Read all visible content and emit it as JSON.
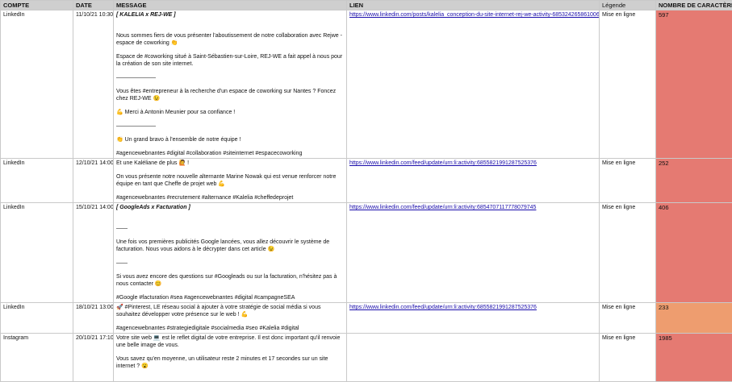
{
  "columns": {
    "compte": "COMPTE",
    "date": "DATE",
    "message": "MESSAGE",
    "lien": "LIEN",
    "legende": "Légende",
    "nombre": "NOMBRE DE CARACTÈRES"
  },
  "colors": {
    "red": "#e57a72",
    "orange": "#ee9d6f",
    "header": "#cfcfcf"
  },
  "rows": [
    {
      "compte": "LinkedIn",
      "date": "11/10/21 10:30",
      "lines": [
        "[ KALELIA x REJ-WE ]",
        "",
        "Nous sommes fiers de vous présenter l'aboutissement de notre collaboration avec Rejwe - espace de coworking 👏",
        "Espace de #coworking situé à Saint-Sébastien-sur-Loire, REJ-WE a fait appel à nous pour la création de son site internet.",
        "———————",
        "Vous êtes #entrepreneur à la recherche d'un espace de coworking sur Nantes ? Foncez chez REJ-WE 😉",
        "💪 Merci à Antonin Meunier pour sa confiance !",
        "———————",
        "👏 Un grand bravo à l'ensemble de notre équipe !",
        "#agencewebnantes #digital #collaboration #siteinternet #espacecoworking"
      ],
      "lien": "https://www.linkedin.com/posts/kalelia_conception-du-site-internet-rej-we-activity-6853242658610061313",
      "legende": "Mise en ligne",
      "nombre": "597",
      "level": "red"
    },
    {
      "compte": "LinkedIn",
      "date": "12/10/21 14:00",
      "lines": [
        "Et une Kaléliane de plus 🙋 !",
        "On vous présente notre nouvelle alternante Marine Nowak qui est venue renforcer notre équipe en tant que Cheffe de projet web 💪",
        "#agencewebnantes #recrutement #alternance #Kalelia #cheffedeprojet"
      ],
      "lien": "https://www.linkedin.com/feed/update/urn:li:activity:6855821991287525376",
      "legende": "Mise en ligne",
      "nombre": "252",
      "level": "red"
    },
    {
      "compte": "LinkedIn",
      "date": "15/10/21 14:00",
      "lines": [
        "[ GoogleAds x Facturation ]",
        "",
        "——",
        "Une fois vos premières publicités Google lancées, vous allez découvrir le système de facturation. Nous vous aidons à le décrypter dans cet article 😉",
        "——",
        "Si vous avez encore des questions sur #Googleads ou sur la facturation, n'hésitez pas à nous contacter 😊",
        "#Google #facturation #sea #agencewebnantes #digital #campagneSEA"
      ],
      "lien": "https://www.linkedin.com/feed/update/urn:li:activity:6854707117778079745",
      "legende": "Mise en ligne",
      "nombre": "406",
      "level": "red"
    },
    {
      "compte": "LinkedIn",
      "date": "18/10/21 13:00",
      "lines": [
        "🚀 #Pinterest, LE réseau social à ajouter à votre stratégie de social média si vous souhaitez développer votre présence sur le web ! 💪",
        "#agencewebnantes #strategiedigitale #socialmedia #seo #Kalelia #digital"
      ],
      "lien": "https://www.linkedin.com/feed/update/urn:li:activity:6855821991287525376",
      "legende": "Mise en ligne",
      "nombre": "233",
      "level": "orange"
    },
    {
      "compte": "Instagram",
      "date": "20/10/21 17:10",
      "lines": [
        "Votre site web 💻 est le reflet digital de votre entreprise. Il est donc important qu'il renvoie une belle image de vous.",
        "Vous savez qu'en moyenne, un utilisateur reste 2 minutes et 17 secondes sur un site internet ? 😮"
      ],
      "lien": "",
      "legende": "Mise en ligne",
      "nombre": "1985",
      "level": "red"
    }
  ]
}
